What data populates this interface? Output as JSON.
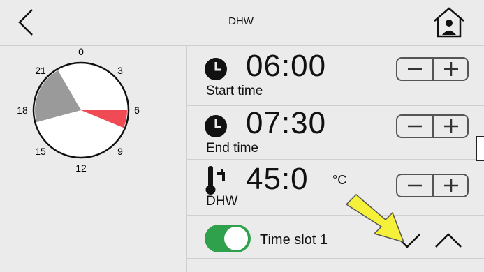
{
  "header": {
    "title": "DHW",
    "back_icon": "chevron-left-icon",
    "home_icon": "home-person-icon"
  },
  "clock": {
    "labels": [
      "0",
      "3",
      "6",
      "9",
      "12",
      "15",
      "18",
      "21"
    ],
    "slots": [
      {
        "name": "Time slot 1",
        "start": "06:00",
        "end": "07:30",
        "color": "#f04b55"
      },
      {
        "name": "",
        "start": "17:00",
        "end": "22:00",
        "color": "#9a9a9a"
      }
    ]
  },
  "start_row": {
    "value": "06:00",
    "label": "Start time",
    "minus": "−",
    "plus": "+"
  },
  "end_row": {
    "value": "07:30",
    "label": "End time",
    "minus": "−",
    "plus": "+"
  },
  "temp_row": {
    "value": "45:0",
    "unit": "°C",
    "label": "DHW",
    "minus": "−",
    "plus": "+"
  },
  "slot_row": {
    "label": "Time slot 1",
    "toggle_on": true
  },
  "colors": {
    "accent_green": "#2fa14c",
    "active_slot": "#f04b55",
    "inactive_slot": "#9a9a9a",
    "annotation_arrow": "#f5f03a"
  }
}
